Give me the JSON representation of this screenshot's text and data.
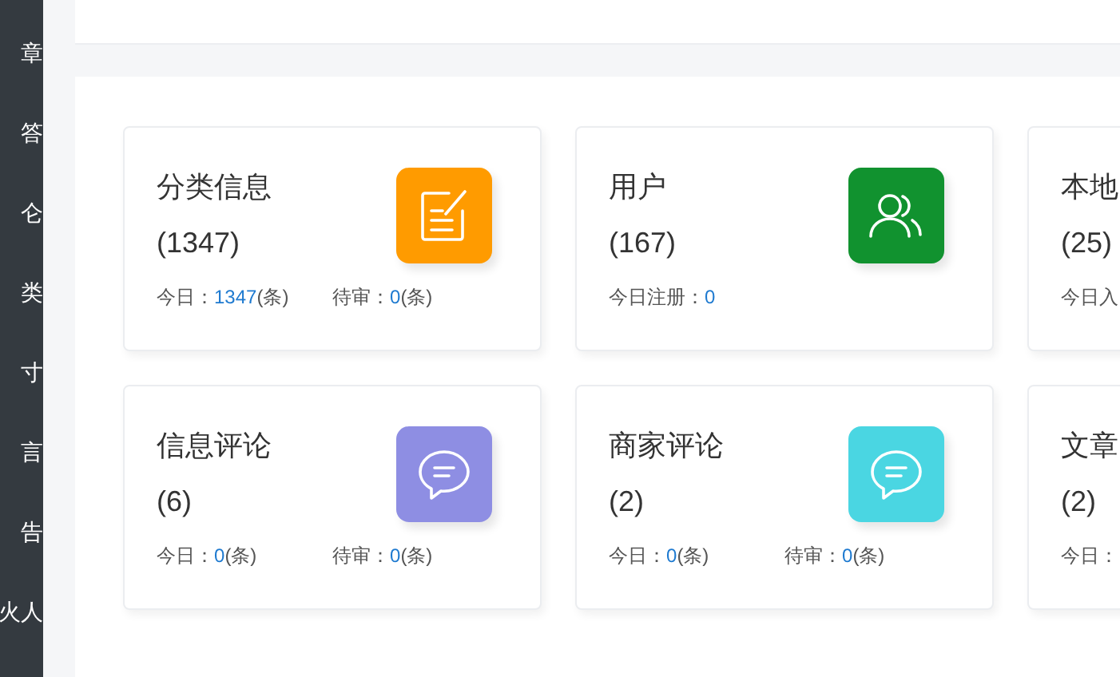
{
  "sidebar": {
    "items": [
      {
        "label": "章"
      },
      {
        "label": "答"
      },
      {
        "label": "仑"
      },
      {
        "label": "类"
      },
      {
        "label": "寸"
      },
      {
        "label": "言"
      },
      {
        "label": "告"
      },
      {
        "label": "火人"
      }
    ]
  },
  "cards": [
    {
      "title": "分类信息",
      "count": "(1347)",
      "kind": "note",
      "color": "#ff9b00",
      "stats": [
        {
          "label": "今日：",
          "value": "1347",
          "unit": "(条)"
        },
        {
          "label": "待审：",
          "value": "0",
          "unit": "(条)"
        }
      ]
    },
    {
      "title": "用户",
      "count": "(167)",
      "kind": "users",
      "color": "#11922f",
      "stats": [
        {
          "label": "今日注册：",
          "value": "0"
        }
      ]
    },
    {
      "title": "本地",
      "count": "(25)",
      "stats": [
        {
          "label": "今日入"
        }
      ]
    },
    {
      "title": "信息评论",
      "count": "(6)",
      "kind": "chat",
      "color": "#8e8ee3",
      "stats": [
        {
          "label": "今日：",
          "value": "0",
          "unit": "(条)"
        },
        {
          "label": "待审：",
          "value": "0",
          "unit": "(条)"
        }
      ]
    },
    {
      "title": "商家评论",
      "count": "(2)",
      "kind": "chat",
      "color": "#4ad6e2",
      "stats": [
        {
          "label": "今日：",
          "value": "0",
          "unit": "(条)"
        },
        {
          "label": "待审：",
          "value": "0",
          "unit": "(条)"
        }
      ]
    },
    {
      "title": "文章",
      "count": "(2)",
      "stats": [
        {
          "label": "今日："
        }
      ]
    }
  ]
}
